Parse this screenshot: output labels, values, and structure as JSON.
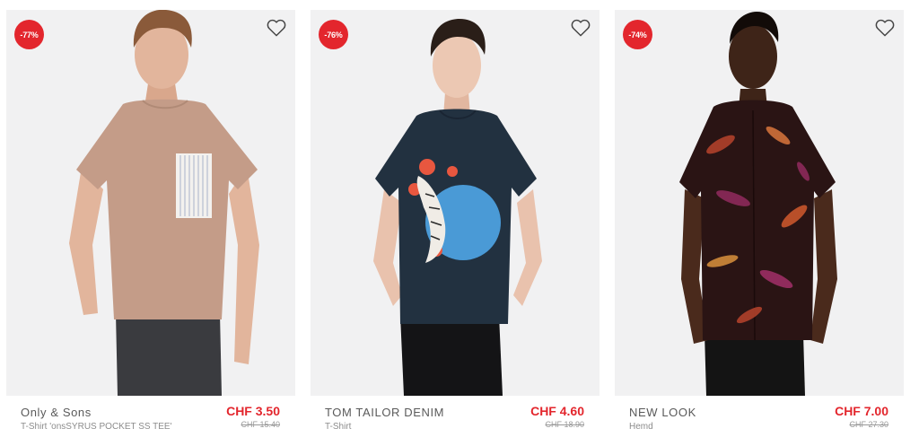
{
  "products": [
    {
      "discount": "-77%",
      "brand": "Only & Sons",
      "subtitle": "T-Shirt 'onsSYRUS POCKET SS TEE'",
      "price": "CHF 3.50",
      "old_price": "CHF 15.40"
    },
    {
      "discount": "-76%",
      "brand": "TOM TAILOR DENIM",
      "subtitle": "T-Shirt",
      "price": "CHF 4.60",
      "old_price": "CHF 18.90"
    },
    {
      "discount": "-74%",
      "brand": "NEW LOOK",
      "subtitle": "Hemd",
      "price": "CHF 7.00",
      "old_price": "CHF 27.30"
    }
  ],
  "icons": {
    "wishlist": "heart-outline-icon"
  },
  "colors": {
    "accent": "#e3262d",
    "card_background": "#f1f1f2",
    "tee_1": "#c49c88",
    "tee_2": "#223140",
    "shirt_3": "#2a1414"
  }
}
